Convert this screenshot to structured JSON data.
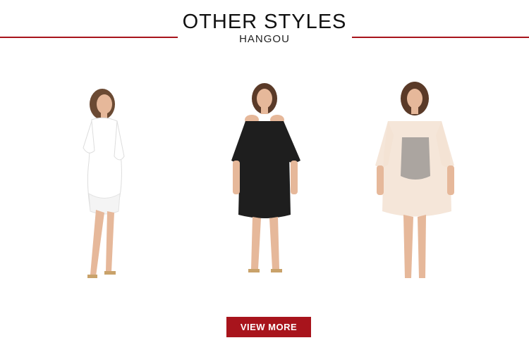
{
  "header": {
    "title": "OTHER STYLES",
    "subtitle": "HANGOU",
    "accent_color": "#a8141c"
  },
  "products": [
    {
      "dress_color": "#ffffff",
      "style": "white cover-up dress"
    },
    {
      "dress_color": "#1e1e1e",
      "style": "black cold-shoulder dress"
    },
    {
      "dress_color": "#f3e2d2",
      "style": "sheer mesh cover-up"
    }
  ],
  "cta": {
    "label": "VIEW MORE",
    "color": "#a8141c"
  }
}
